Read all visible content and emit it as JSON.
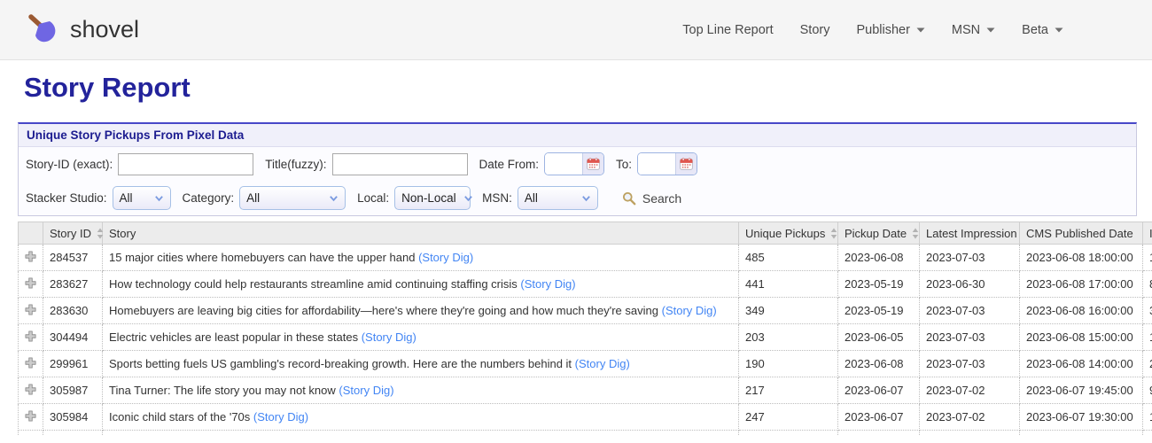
{
  "brand": {
    "name": "shovel"
  },
  "nav": {
    "items": [
      {
        "label": "Top Line Report",
        "dropdown": false
      },
      {
        "label": "Story",
        "dropdown": false
      },
      {
        "label": "Publisher",
        "dropdown": true
      },
      {
        "label": "MSN",
        "dropdown": true
      },
      {
        "label": "Beta",
        "dropdown": true
      }
    ]
  },
  "page": {
    "title": "Story Report"
  },
  "filter_panel": {
    "header": "Unique Story Pickups From Pixel Data",
    "story_id": {
      "label": "Story-ID (exact):",
      "value": ""
    },
    "title": {
      "label": "Title(fuzzy):",
      "value": ""
    },
    "date_from": {
      "label": "Date From:",
      "value": ""
    },
    "date_to": {
      "label": "To:",
      "value": ""
    },
    "stacker_studio": {
      "label": "Stacker Studio:",
      "value": "All"
    },
    "category": {
      "label": "Category:",
      "value": "All"
    },
    "local": {
      "label": "Local:",
      "value": "Non-Local"
    },
    "msn": {
      "label": "MSN:",
      "value": "All"
    },
    "search_label": "Search"
  },
  "table": {
    "columns": [
      {
        "label": "",
        "sortable": false
      },
      {
        "label": "Story ID",
        "sortable": true
      },
      {
        "label": "Story",
        "sortable": false
      },
      {
        "label": "Unique Pickups",
        "sortable": true
      },
      {
        "label": "Pickup Date",
        "sortable": true
      },
      {
        "label": "Latest Impression",
        "sortable": false
      },
      {
        "label": "CMS Published Date",
        "sortable": false
      },
      {
        "label": "Impressions",
        "sortable": false
      }
    ],
    "story_dig_label": "(Story Dig)",
    "rows": [
      {
        "story_id": "284537",
        "story": "15 major cities where homebuyers can have the upper hand",
        "unique_pickups": "485",
        "pickup_date": "2023-06-08",
        "latest_impression": "2023-07-03",
        "cms_published_date": "2023-06-08 18:00:00",
        "impressions_partial": "1"
      },
      {
        "story_id": "283627",
        "story": "How technology could help restaurants streamline amid continuing staffing crisis",
        "unique_pickups": "441",
        "pickup_date": "2023-05-19",
        "latest_impression": "2023-06-30",
        "cms_published_date": "2023-06-08 17:00:00",
        "impressions_partial": "8"
      },
      {
        "story_id": "283630",
        "story": "Homebuyers are leaving big cities for affordability—here's where they're going and how much they're saving",
        "unique_pickups": "349",
        "pickup_date": "2023-05-19",
        "latest_impression": "2023-07-03",
        "cms_published_date": "2023-06-08 16:00:00",
        "impressions_partial": "3"
      },
      {
        "story_id": "304494",
        "story": "Electric vehicles are least popular in these states",
        "unique_pickups": "203",
        "pickup_date": "2023-06-05",
        "latest_impression": "2023-07-03",
        "cms_published_date": "2023-06-08 15:00:00",
        "impressions_partial": "1"
      },
      {
        "story_id": "299961",
        "story": "Sports betting fuels US gambling's record-breaking growth. Here are the numbers behind it",
        "unique_pickups": "190",
        "pickup_date": "2023-06-08",
        "latest_impression": "2023-07-03",
        "cms_published_date": "2023-06-08 14:00:00",
        "impressions_partial": "2"
      },
      {
        "story_id": "305987",
        "story": "Tina Turner: The life story you may not know",
        "unique_pickups": "217",
        "pickup_date": "2023-06-07",
        "latest_impression": "2023-07-02",
        "cms_published_date": "2023-06-07 19:45:00",
        "impressions_partial": "9"
      },
      {
        "story_id": "305984",
        "story": "Iconic child stars of the '70s",
        "unique_pickups": "247",
        "pickup_date": "2023-06-07",
        "latest_impression": "2023-07-02",
        "cms_published_date": "2023-06-07 19:30:00",
        "impressions_partial": "1"
      }
    ]
  },
  "colors": {
    "title_navy": "#23239b",
    "panel_accent_blue": "#4848c8",
    "link_blue": "#4285f4",
    "blade_purple": "#6f66e3",
    "handle_brown": "#9b5a33",
    "topbar_gray": "#f5f5f5",
    "header_row_gray": "#ececec"
  }
}
